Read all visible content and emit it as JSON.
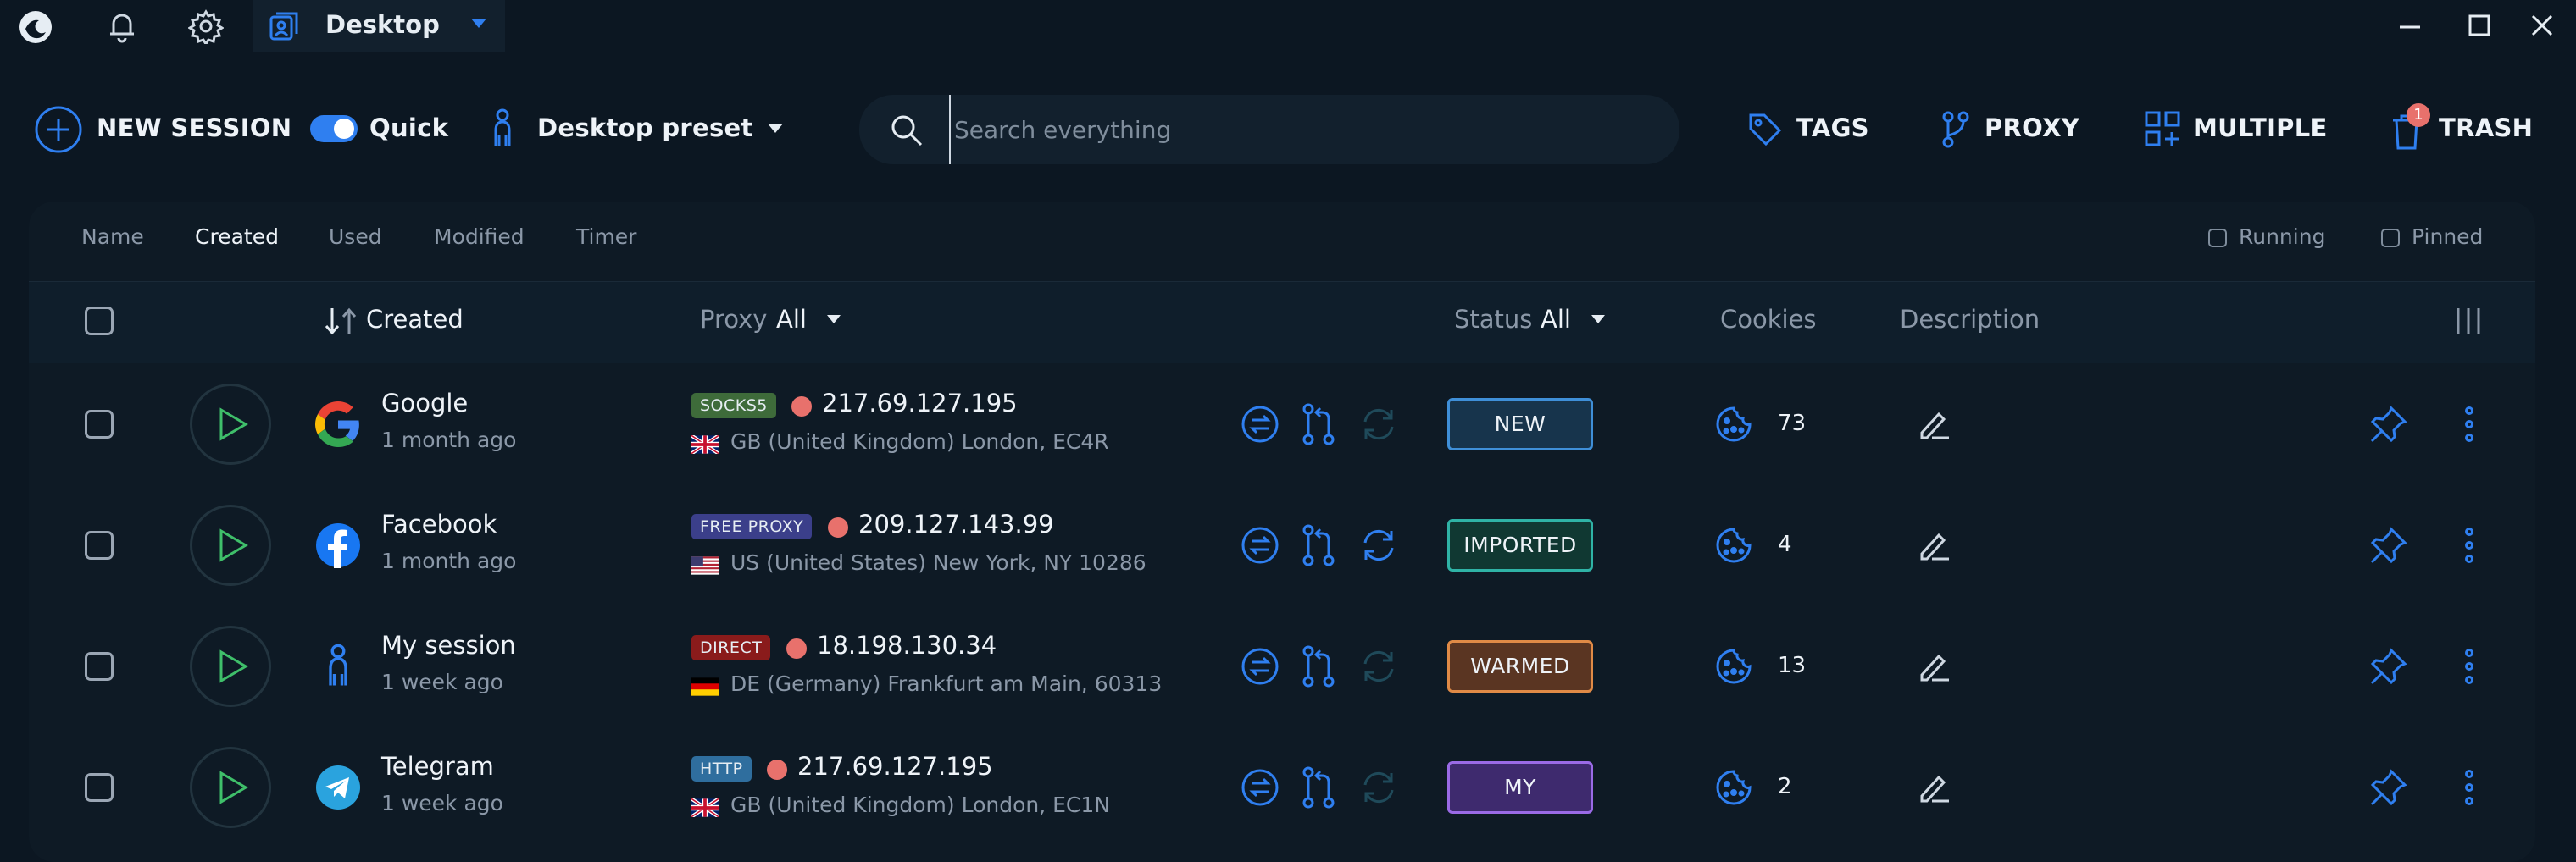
{
  "titlebar": {
    "active_tab": "Desktop"
  },
  "toolbar": {
    "new_session": "NEW SESSION",
    "quick_label": "Quick",
    "quick_on": true,
    "preset": "Desktop preset",
    "search_placeholder": "Search everything",
    "tags": "TAGS",
    "proxy": "PROXY",
    "multiple": "MULTIPLE",
    "trash": "TRASH",
    "trash_count": "1"
  },
  "sort_tabs": [
    "Name",
    "Created",
    "Used",
    "Modified",
    "Timer"
  ],
  "active_sort": "Created",
  "filters": {
    "running": "Running",
    "pinned": "Pinned"
  },
  "columns": {
    "created": "Created",
    "proxy": "Proxy",
    "proxy_filter": "All",
    "status": "Status",
    "status_filter": "All",
    "cookies": "Cookies",
    "description": "Description"
  },
  "rows": [
    {
      "name": "Google",
      "time": "1 month ago",
      "icon": "google-icon",
      "proxy_type": "SOCKS5",
      "proxy_color": "#3e6b3a",
      "ip": "217.69.127.195",
      "flag": "gb",
      "location": "GB (United Kingdom) London, EC4R",
      "status": "NEW",
      "status_border": "#3f8fd8",
      "status_bg": "#17344c",
      "cookies": "73"
    },
    {
      "name": "Facebook",
      "time": "1 month ago",
      "icon": "facebook-icon",
      "proxy_type": "FREE PROXY",
      "proxy_color": "#3b3f8a",
      "ip": "209.127.143.99",
      "flag": "us",
      "location": "US (United States) New York, NY 10286",
      "status": "IMPORTED",
      "status_border": "#2fb3a6",
      "status_bg": "#103832",
      "cookies": "4"
    },
    {
      "name": "My session",
      "time": "1 week ago",
      "icon": "person-icon",
      "proxy_type": "DIRECT",
      "proxy_color": "#8a1b1b",
      "ip": "18.198.130.34",
      "flag": "de",
      "location": "DE (Germany) Frankfurt am Main, 60313",
      "status": "WARMED",
      "status_border": "#e08a46",
      "status_bg": "#5a3522",
      "cookies": "13"
    },
    {
      "name": "Telegram",
      "time": "1 week ago",
      "icon": "telegram-icon",
      "proxy_type": "HTTP",
      "proxy_color": "#2f6e9e",
      "ip": "217.69.127.195",
      "flag": "gb",
      "location": "GB (United Kingdom) London, EC1N",
      "status": "MY",
      "status_border": "#9a6ae6",
      "status_bg": "#3e2a6e",
      "cookies": "2"
    }
  ]
}
